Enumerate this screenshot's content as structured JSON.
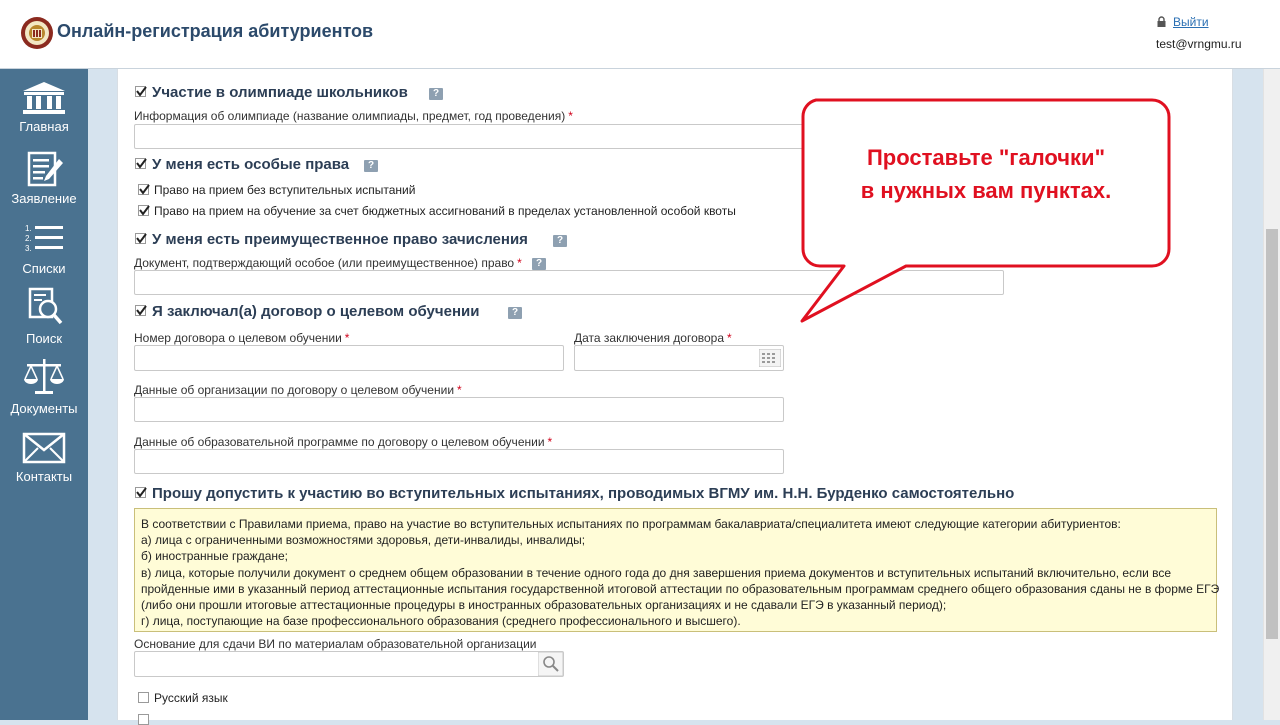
{
  "header": {
    "title": "Онлайн-регистрация абитуриентов",
    "logout_label": "Выйти",
    "user_email": "test@vrngmu.ru"
  },
  "sidebar": {
    "items": [
      {
        "label": "Главная",
        "icon": "bank-building-icon"
      },
      {
        "label": "Заявление",
        "icon": "document-edit-icon"
      },
      {
        "label": "Списки",
        "icon": "numbered-list-icon"
      },
      {
        "label": "Поиск",
        "icon": "search-document-icon"
      },
      {
        "label": "Документы",
        "icon": "scales-icon"
      },
      {
        "label": "Контакты",
        "icon": "envelope-icon"
      }
    ]
  },
  "form": {
    "olympiad": {
      "checked": true,
      "label": "Участие в олимпиаде школьников",
      "field_label": "Информация об олимпиаде (название олимпиады, предмет, год проведения)",
      "value": ""
    },
    "special_rights": {
      "checked": true,
      "label": "У меня есть особые права",
      "options": [
        {
          "label": "Право на прием без вступительных испытаний",
          "checked": true
        },
        {
          "label": "Право на прием на обучение за счет бюджетных ассигнований в пределах установленной особой квоты",
          "checked": true
        }
      ]
    },
    "priority_right": {
      "checked": true,
      "label": "У меня есть преимущественное право зачисления",
      "field_label": "Документ, подтверждающий особое (или преимущественное) право",
      "value": ""
    },
    "target_contract": {
      "checked": true,
      "label": "Я заключал(а) договор о целевом обучении",
      "contract_number_label": "Номер договора о целевом обучении",
      "contract_date_label": "Дата заключения договора",
      "organization_label": "Данные об организации по договору о целевом обучении",
      "program_label": "Данные об образовательной программе по договору о целевом обучении"
    },
    "own_exams": {
      "checked": true,
      "label": "Прошу допустить к участию во вступительных испытаниях, проводимых ВГМУ им. Н.Н. Бурденко самостоятельно",
      "notice_lines": [
        "В соответствии с Правилами приема, право на участие во вступительных испытаниях по программам бакалавриата/специалитета имеют следующие категории абитуриентов:",
        "а) лица с ограниченными возможностями здоровья, дети-инвалиды, инвалиды;",
        "б) иностранные граждане;",
        "в) лица, которые получили документ о среднем общем образовании в течение одного года до дня завершения приема документов и вступительных испытаний включительно, если все",
        "пройденные ими в указанный период аттестационные испытания государственной итоговой аттестации по образовательным программам среднего общего образования сданы не в форме ЕГЭ",
        "(либо они прошли итоговые аттестационные процедуры в иностранных образовательных организациях и не сдавали ЕГЭ в указанный период);",
        "г) лица, поступающие на базе профессионального образования (среднего профессионального и высшего)."
      ],
      "basis_label": "Основание для сдачи ВИ по материалам образовательной организации",
      "subjects": [
        {
          "label": "Русский язык",
          "checked": false
        }
      ]
    }
  },
  "callout": {
    "line1": "Проставьте \"галочки\"",
    "line2": "в нужных вам пунктах."
  },
  "colors": {
    "sidebar": "#4a7290",
    "accent_text": "#2c4a6b",
    "callout_red": "#e01020",
    "notice_bg": "#fffcd7"
  }
}
